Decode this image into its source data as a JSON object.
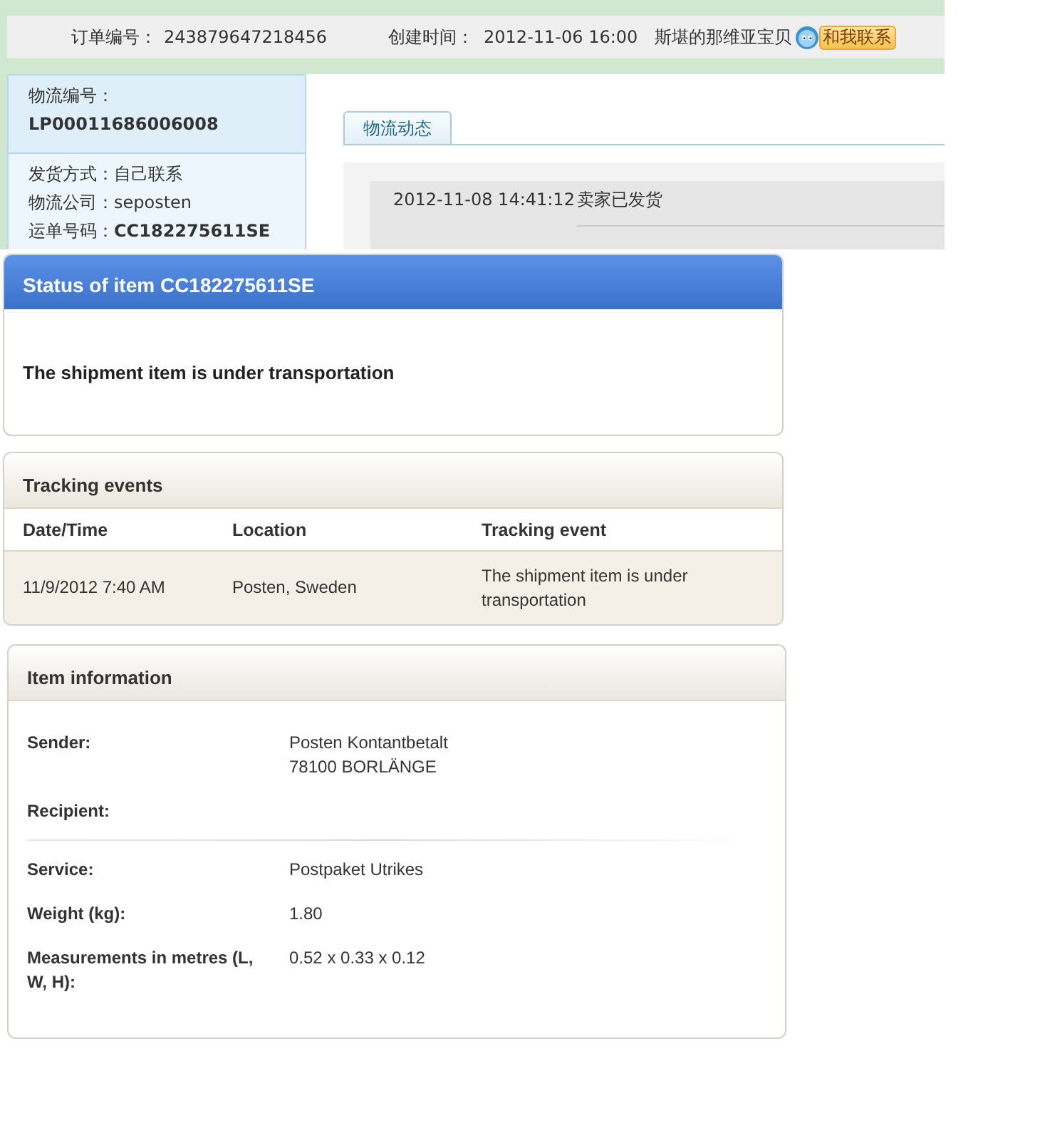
{
  "order_bar": {
    "order_label": "订单编号：",
    "order_number": "243879647218456",
    "created_label": "创建时间：",
    "created_time": "2012-11-06 16:00",
    "seller": "斯堪的那维亚宝贝",
    "contact_button": "和我联系"
  },
  "logistics_info": {
    "number_label": "物流编号：",
    "number": "LP00011686006008",
    "fields": [
      {
        "label": "发货方式：",
        "value": "自己联系",
        "bold": false
      },
      {
        "label": "物流公司：",
        "value": "seposten",
        "bold": false
      },
      {
        "label": "运单号码：",
        "value": "CC182275611SE",
        "bold": true
      }
    ]
  },
  "logistics_tabs": [
    {
      "label": "物流动态",
      "selected": true
    }
  ],
  "logistics_events": [
    {
      "time": "2012-11-08 14:41:12",
      "event": "卖家已发货"
    }
  ],
  "status": {
    "title": "Status of item CC182275611SE",
    "message": "The shipment item is under transportation"
  },
  "tracking_events": {
    "title": "Tracking events",
    "columns": [
      "Date/Time",
      "Location",
      "Tracking event"
    ],
    "rows": [
      [
        "11/9/2012 7:40 AM",
        "Posten, Sweden",
        "The shipment item is under transportation"
      ]
    ]
  },
  "item_information": {
    "title": "Item information",
    "sections": [
      {
        "rows": [
          {
            "label": "Sender:",
            "value": [
              "Posten Kontantbetalt",
              "78100 BORLÄNGE"
            ]
          },
          {
            "label": "Recipient:"
          }
        ]
      },
      {
        "rows": [
          {
            "label": "Service:",
            "value": [
              "Postpaket Utrikes"
            ]
          },
          {
            "label": "Weight (kg):",
            "value": [
              "1.80"
            ]
          },
          {
            "label": "Measurements in metres (L, W, H):",
            "value": [
              "0.52 x 0.33 x 0.12"
            ]
          }
        ]
      }
    ]
  }
}
